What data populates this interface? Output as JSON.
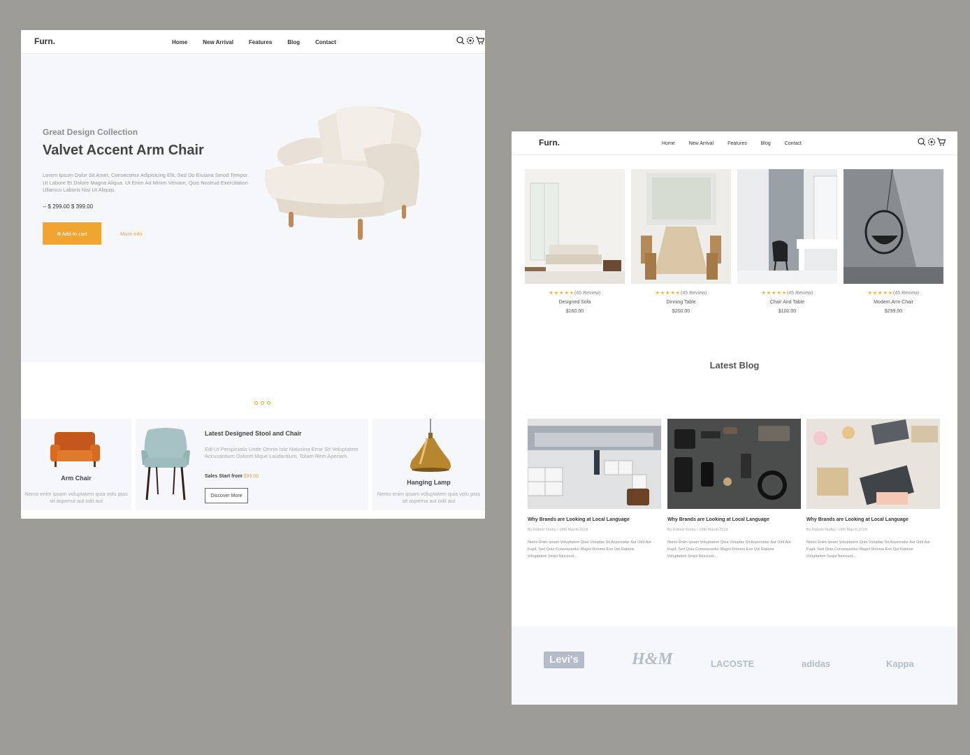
{
  "colors": {
    "accent": "#f0a530",
    "background": "#9d9b95",
    "hero_bg": "#f6f7fb",
    "star": "#f3b51e"
  },
  "nav": {
    "logo": "Furn.",
    "items": [
      "Home",
      "New Arrival",
      "Features",
      "Blog",
      "Contact"
    ],
    "icons": [
      "search-icon",
      "settings-icon",
      "cart-icon"
    ]
  },
  "hero": {
    "subtitle": "Great Design Collection",
    "title": "Valvet Accent Arm Chair",
    "description": "Lorem Ipsum Dolor Sit Amet, Consectetur Adipisicing Elit, Sed Do Eiuiana Smod Tempor Ut Labore Et Dolore Magna Aliqua. Ut Enim Ad Minim Veniam, Quis Nostrud Exercitation Ullamco Laboris Nisi Ut Aliquip.",
    "price": "-- $ 299.00 $ 399.00",
    "cart_button": "Add to cart",
    "more_info": "More info"
  },
  "features": {
    "arm_chair": {
      "title": "Arm Chair",
      "desc": "Nemo enim ipsam voluptatem quia volu ptas sit asperna aut odit aut"
    },
    "stool": {
      "title": "Latest Designed Stool and Chair",
      "desc": "Edi Ut Perspiciatis Unde Omnis Iste Natusina Error Sit Voluptatem Accusantium Doloret Mque Laudantium, Totam Rem Aperiam.",
      "sales_label": "Sales Start from",
      "sales_price": "$99.00",
      "button": "Discover More"
    },
    "lamp": {
      "title": "Hanging Lamp",
      "desc": "Nemo enim ipsam voluptatem quia volu ptas sit asperna aut odit aut"
    }
  },
  "products": [
    {
      "name": "Designed Sofa",
      "price": "$160.00",
      "reviews": "(45 Review)",
      "rating": 5
    },
    {
      "name": "Dinning Table",
      "price": "$200.00",
      "reviews": "(45 Review)",
      "rating": 5
    },
    {
      "name": "Chair And Table",
      "price": "$100.00",
      "reviews": "(45 Review)",
      "rating": 5
    },
    {
      "name": "Modern Arm Chair",
      "price": "$299.00",
      "reviews": "(45 Review)",
      "rating": 5
    }
  ],
  "blog": {
    "heading": "Latest Blog",
    "posts": [
      {
        "title": "Why Brands are Looking at Local Language",
        "meta": "By Robert Norby / 18th March 2018",
        "text": "Nemo Enim Ipsam Voluptatem Quia Voluptas Sit Aspernatur Aut Odit Aut Fugit, Sed Quia Consequuntur Magni Dolores Eos Qui Ratione Voluptatem Sequi Nesciunt...."
      },
      {
        "title": "Why Brands are Looking at Local Language",
        "meta": "By Robert Norby / 18th March 2018",
        "text": "Nemo Enim Ipsam Voluptatem Quia Voluptas Sit Aspernatur Aut Odit Aut Fugit, Sed Quia Consequuntur Magni Dolores Eos Qui Ratione Voluptatem Sequi Nesciunt...."
      },
      {
        "title": "Why Brands are Looking at Local Language",
        "meta": "By Robert Norby / 18th March 2018",
        "text": "Nemo Enim Ipsam Voluptatem Quia Voluptas Sit Aspernatur Aut Odit Aut Fugit, Sed Quia Consequuntur Magni Dolores Eos Qui Ratione Voluptatem Sequi Nesciunt...."
      }
    ]
  },
  "brands": [
    "Levi's",
    "H&M",
    "LACOSTE",
    "adidas",
    "Kappa"
  ]
}
